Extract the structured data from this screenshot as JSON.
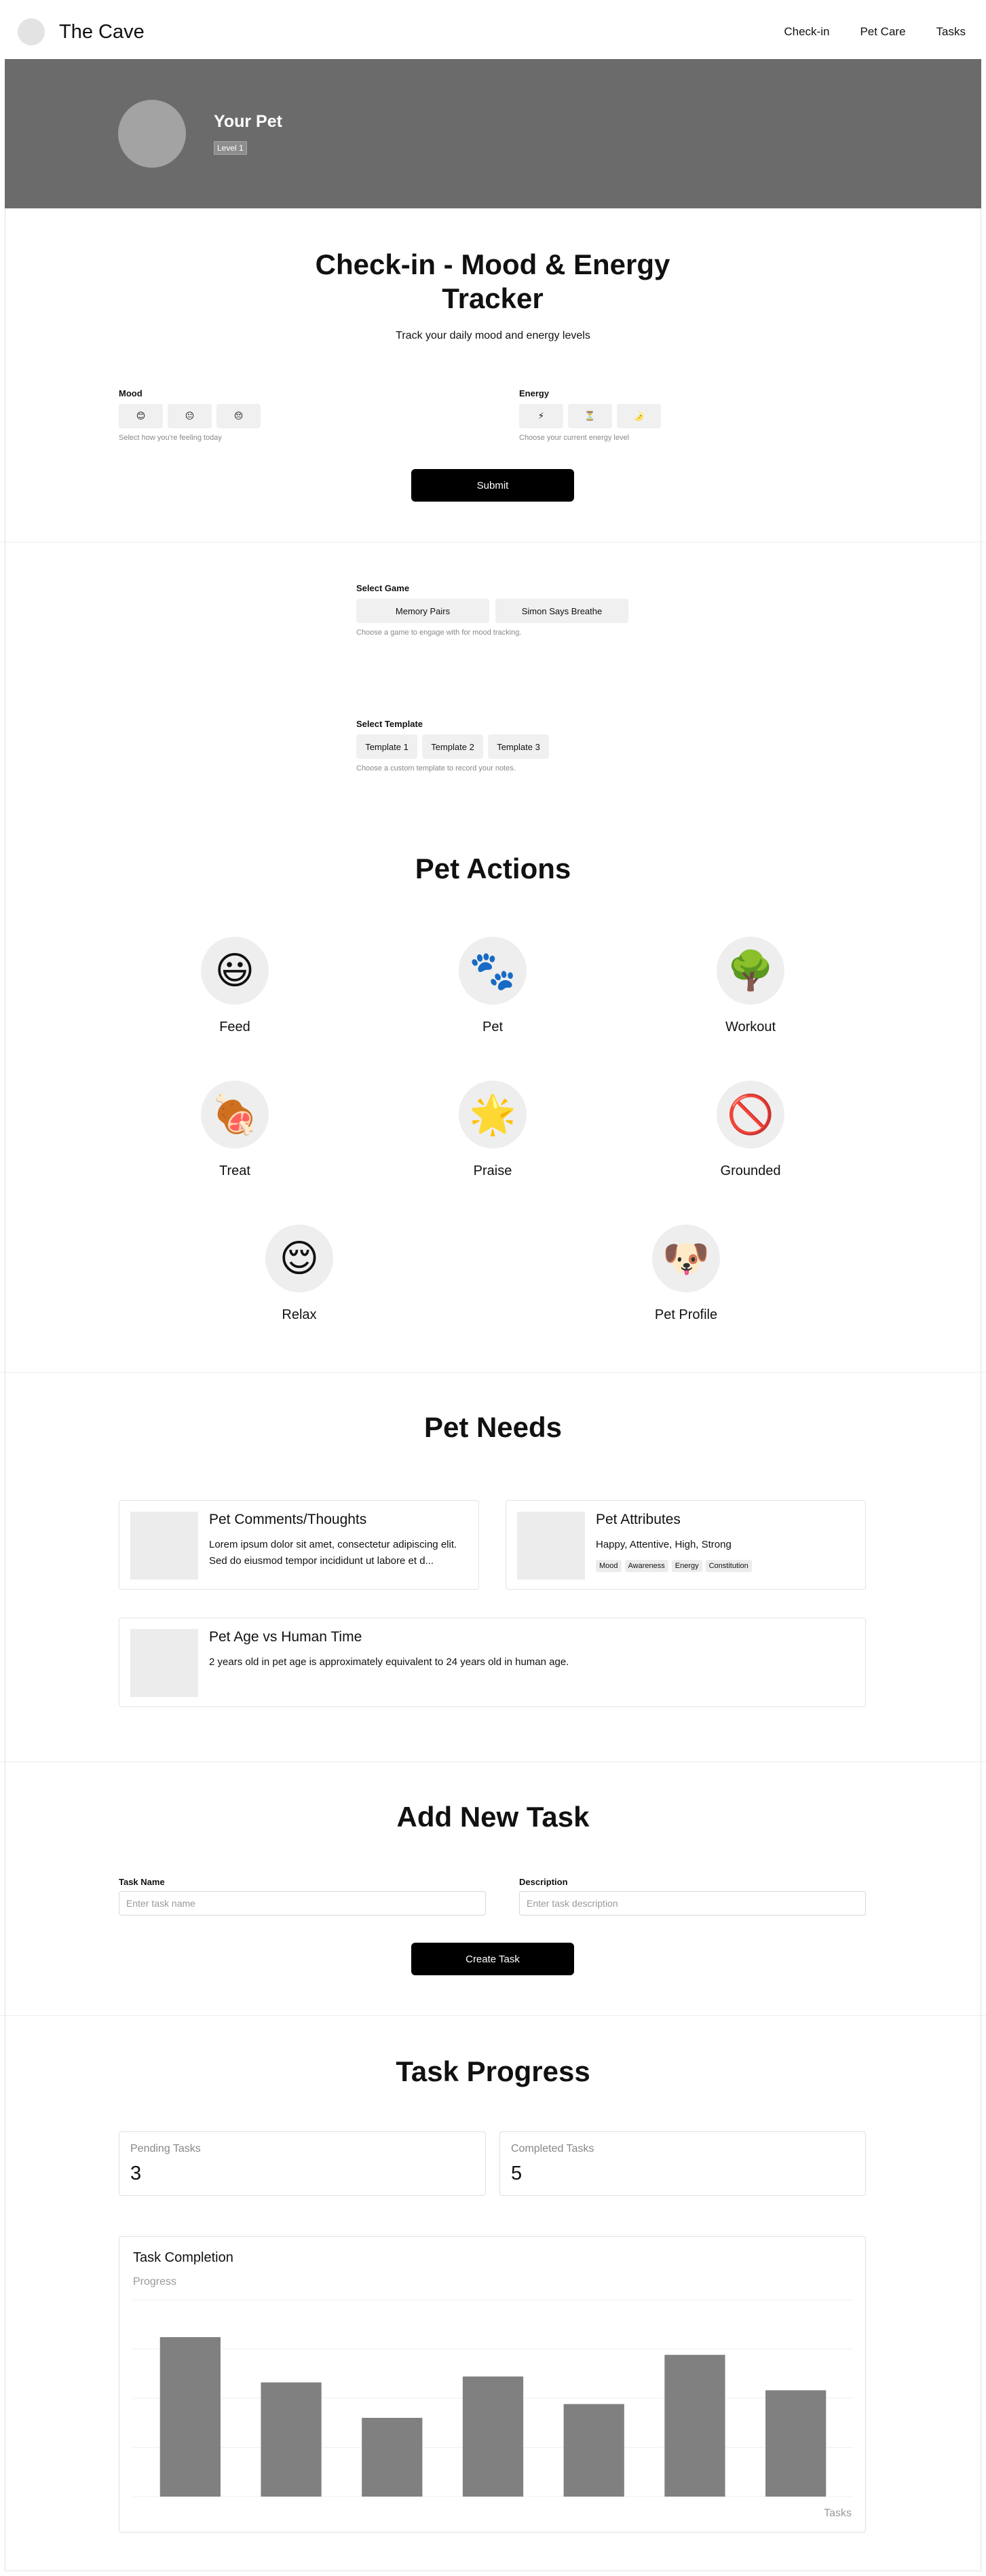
{
  "header": {
    "brand": "The Cave",
    "nav": [
      "Check-in",
      "Pet Care",
      "Tasks"
    ]
  },
  "hero": {
    "pet_name": "Your Pet",
    "level": "Level 1"
  },
  "checkin": {
    "title": "Check-in - Mood & Energy Tracker",
    "subtitle": "Track your daily mood and energy levels",
    "mood": {
      "label": "Mood",
      "options": [
        "😊",
        "😐",
        "😔"
      ],
      "hint": "Select how you're feeling today"
    },
    "energy": {
      "label": "Energy",
      "options": [
        "⚡",
        "⏳",
        "🌛"
      ],
      "hint": "Choose your current energy level"
    },
    "submit_label": "Submit"
  },
  "game": {
    "label": "Select Game",
    "options": [
      "Memory Pairs",
      "Simon Says Breathe"
    ],
    "hint": "Choose a game to engage with for mood tracking."
  },
  "template": {
    "label": "Select Template",
    "options": [
      "Template 1",
      "Template 2",
      "Template 3"
    ],
    "hint": "Choose a custom template to record your notes."
  },
  "actions": {
    "title": "Pet Actions",
    "items": [
      {
        "icon": "😃",
        "label": "Feed"
      },
      {
        "icon": "🐾",
        "label": "Pet"
      },
      {
        "icon": "🌳",
        "label": "Workout"
      },
      {
        "icon": "🍖",
        "label": "Treat"
      },
      {
        "icon": "🌟",
        "label": "Praise"
      },
      {
        "icon": "🚫",
        "label": "Grounded"
      },
      {
        "icon": "😌",
        "label": "Relax"
      },
      {
        "icon": "🐶",
        "label": "Pet Profile"
      }
    ]
  },
  "needs": {
    "title": "Pet Needs",
    "comments": {
      "title": "Pet Comments/Thoughts",
      "text": "Lorem ipsum dolor sit amet, consectetur adipiscing elit. Sed do eiusmod tempor incididunt ut labore et d..."
    },
    "attributes": {
      "title": "Pet Attributes",
      "text": "Happy, Attentive, High, Strong",
      "tags": [
        "Mood",
        "Awareness",
        "Energy",
        "Constitution"
      ]
    },
    "age": {
      "title": "Pet Age vs Human Time",
      "text": "2 years old in pet age is approximately equivalent to 24 years old in human age."
    }
  },
  "add_task": {
    "title": "Add New Task",
    "name_label": "Task Name",
    "name_placeholder": "Enter task name",
    "desc_label": "Description",
    "desc_placeholder": "Enter task description",
    "create_label": "Create Task"
  },
  "progress": {
    "title": "Task Progress",
    "pending_label": "Pending Tasks",
    "pending_value": "3",
    "completed_label": "Completed Tasks",
    "completed_value": "5",
    "chart_title": "Task Completion"
  },
  "chart_data": {
    "type": "bar",
    "title": "Task Completion",
    "ylabel": "Progress",
    "xlabel": "Tasks",
    "values": [
      81,
      58,
      40,
      61,
      47,
      72,
      54
    ],
    "ylim": [
      0,
      100
    ],
    "grid": true,
    "bar_color": "#808080"
  }
}
